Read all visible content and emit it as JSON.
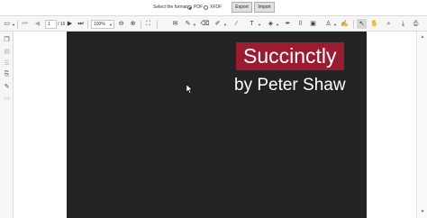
{
  "format_bar": {
    "label": "Select the format:",
    "options": [
      "PDF",
      "XFDF"
    ],
    "selected": "PDF",
    "export_label": "Export",
    "import_label": "Import"
  },
  "toolbar": {
    "page_number": "1",
    "page_count": "/ 16",
    "zoom": "100%"
  },
  "document": {
    "title": "Succinctly",
    "subtitle": "by Peter Shaw"
  },
  "colors": {
    "page_background": "#232326",
    "title_background": "#9b1b30"
  }
}
